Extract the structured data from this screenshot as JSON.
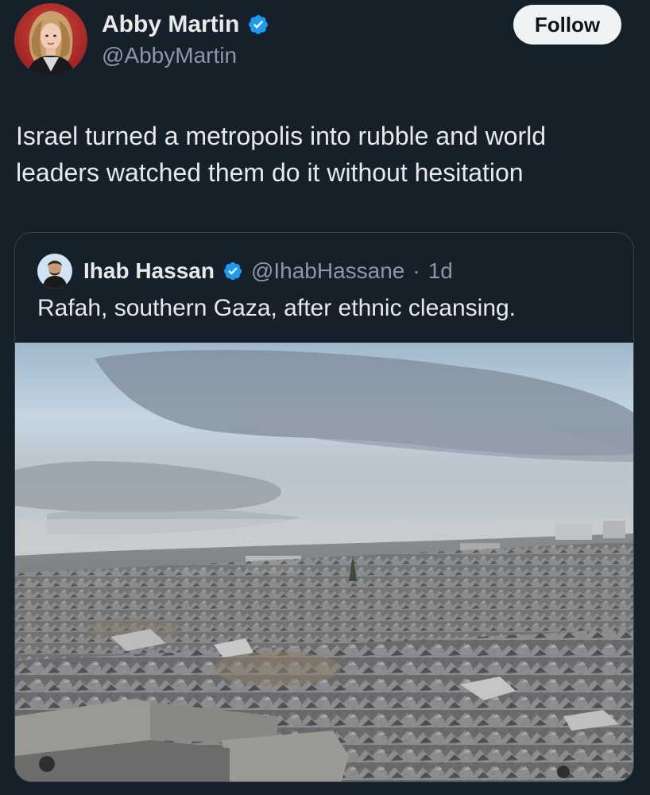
{
  "author": {
    "display_name": "Abby Martin",
    "handle": "@AbbyMartin",
    "verified": true,
    "avatar_icon": "profile-photo"
  },
  "follow_label": "Follow",
  "tweet_text": "Israel turned a metropolis into rubble and world leaders watched them do it without hesitation",
  "quoted": {
    "display_name": "Ihab Hassan",
    "handle": "@IhabHassane",
    "separator": "·",
    "time": "1d",
    "verified": true,
    "avatar_icon": "profile-photo",
    "text": "Rafah, southern Gaza, after ethnic cleansing."
  },
  "colors": {
    "background": "#15202b",
    "text": "#e7e9ea",
    "secondary_text": "#8b98a5",
    "verified_blue": "#1d9bf0",
    "follow_bg": "#eff3f4",
    "border": "#38444d"
  }
}
